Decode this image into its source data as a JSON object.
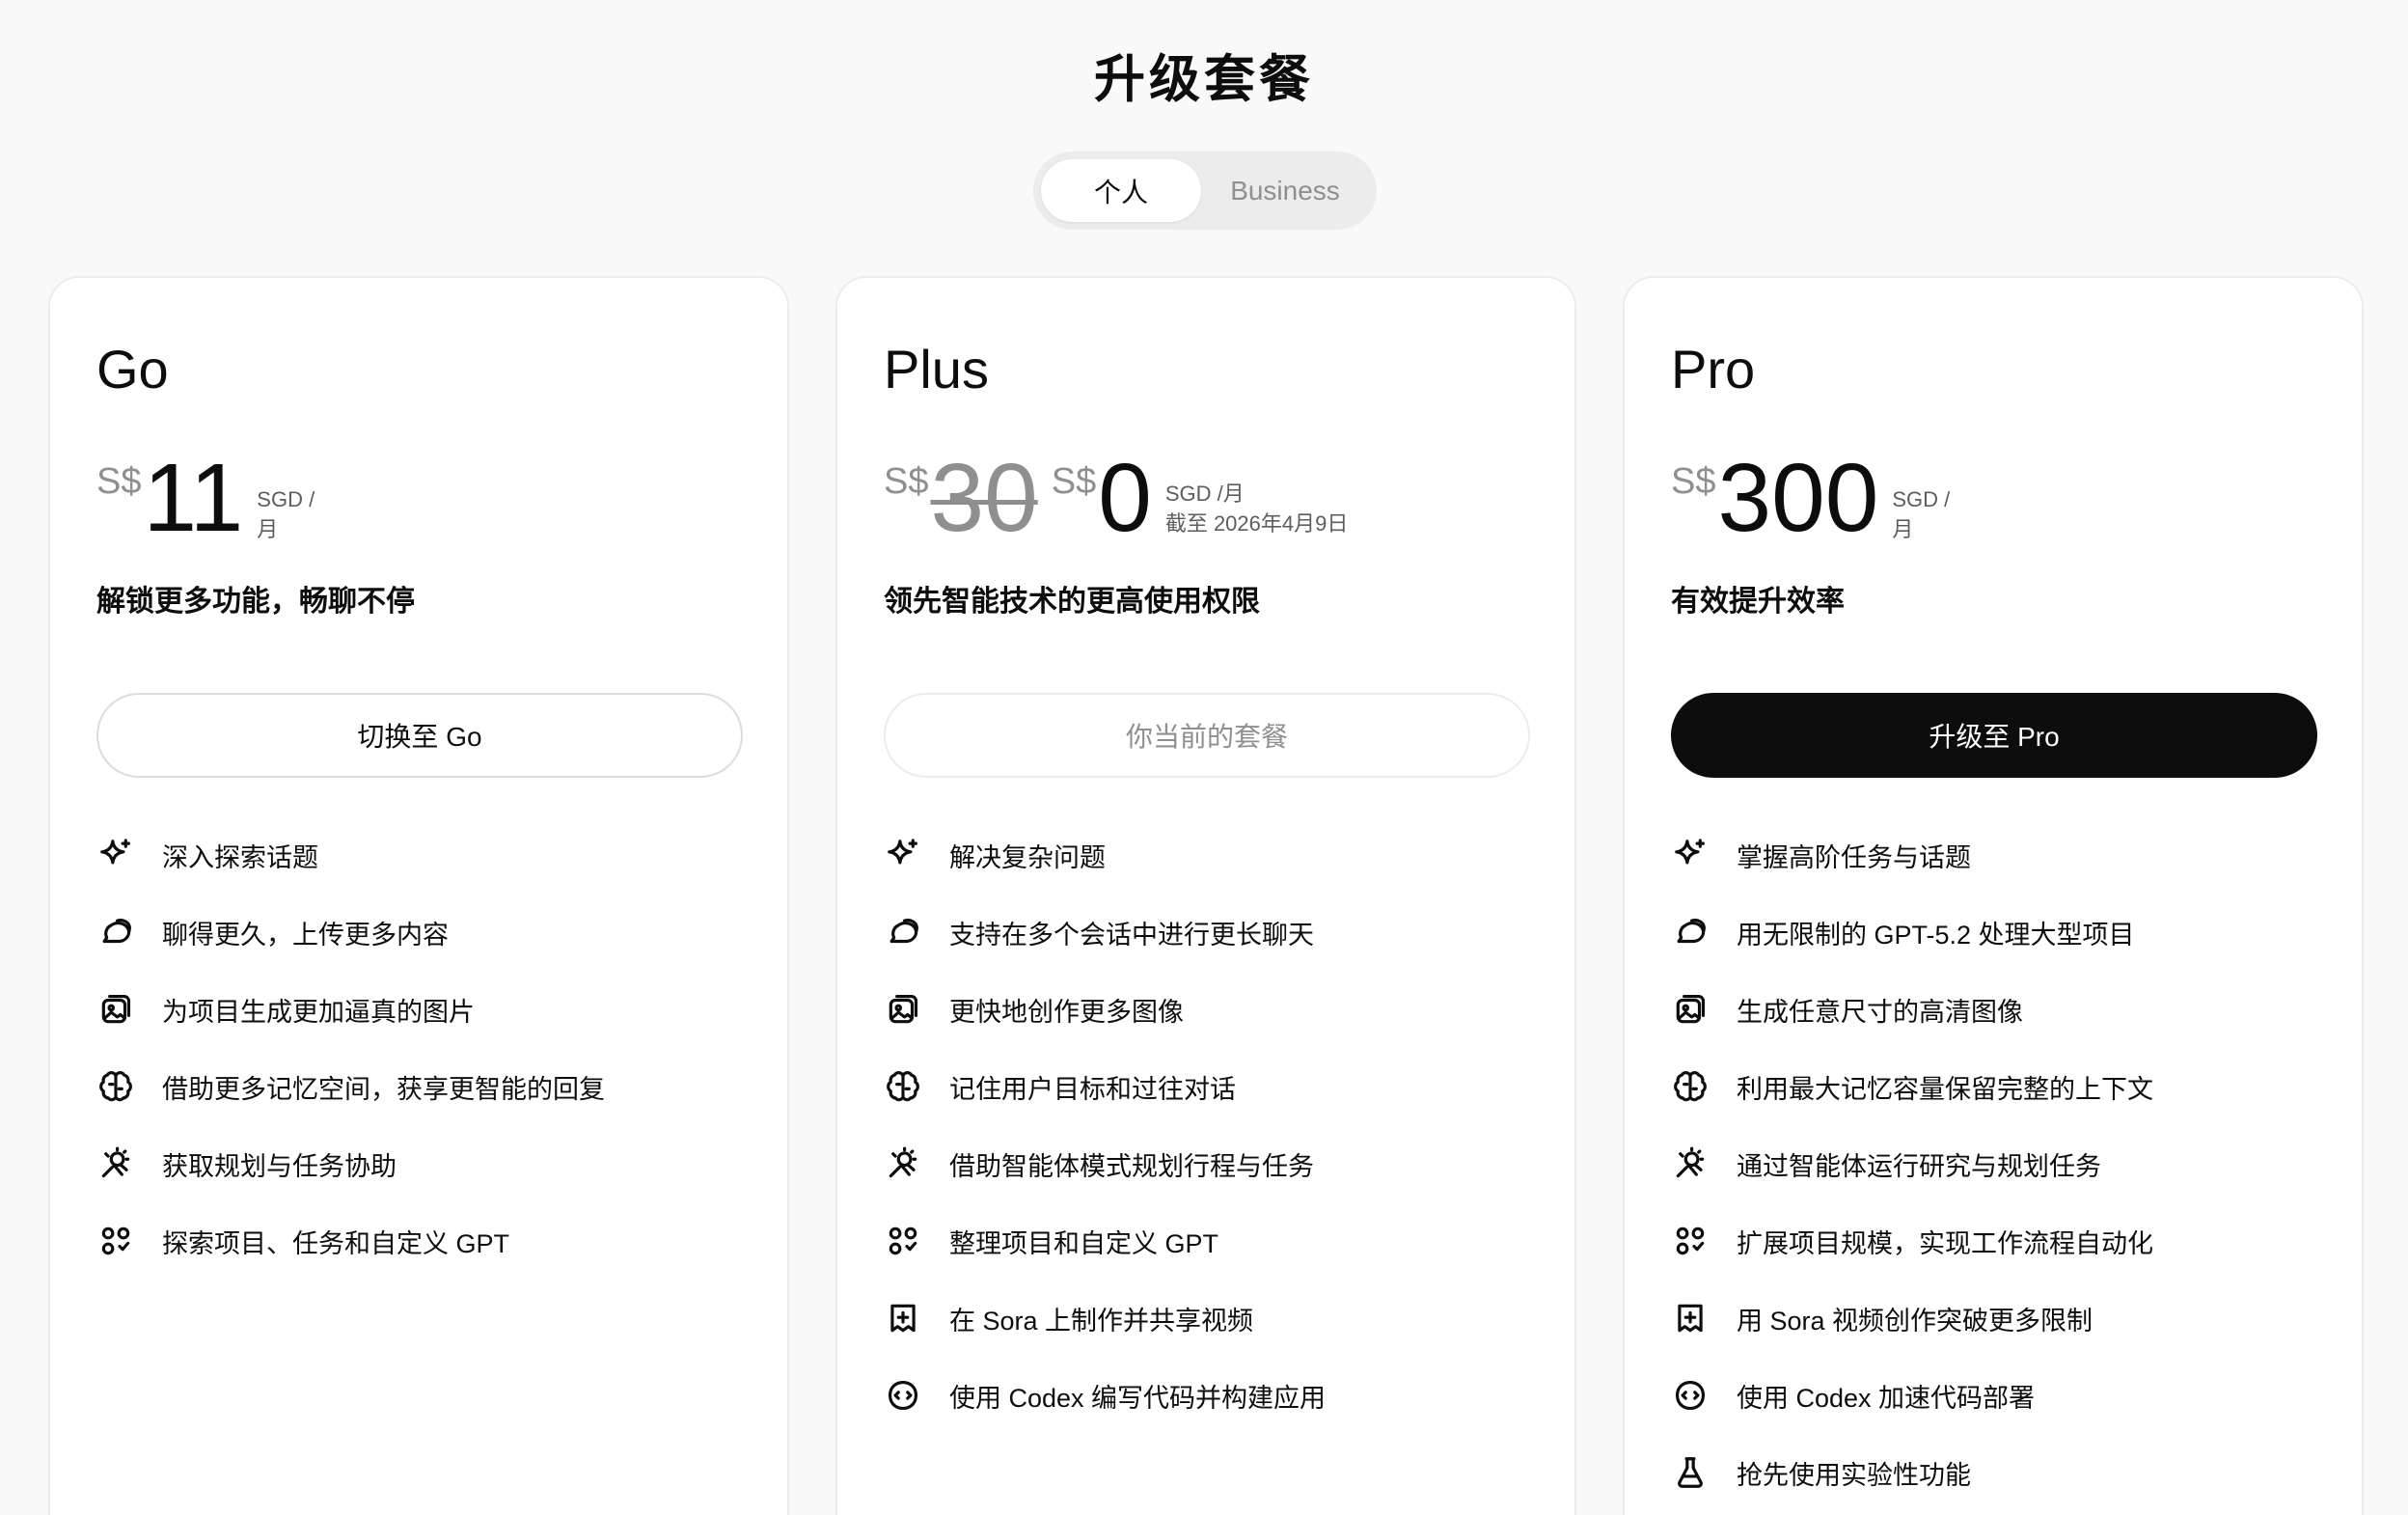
{
  "title": "升级套餐",
  "toggle": {
    "personal": "个人",
    "business": "Business"
  },
  "plans": {
    "go": {
      "name": "Go",
      "currency": "S$",
      "price": "11",
      "unit_line1": "SGD /",
      "unit_line2": "月",
      "tagline": "解锁更多功能，畅聊不停",
      "cta": "切换至 Go",
      "features": [
        "深入探索话题",
        "聊得更久，上传更多内容",
        "为项目生成更加逼真的图片",
        "借助更多记忆空间，获享更智能的回复",
        "获取规划与任务协助",
        "探索项目、任务和自定义 GPT"
      ]
    },
    "plus": {
      "name": "Plus",
      "currency": "S$",
      "old_price": "30",
      "price": "0",
      "unit_line1": "SGD /月",
      "unit_line2": "截至 2026年4月9日",
      "tagline": "领先智能技术的更高使用权限",
      "cta": "你当前的套餐",
      "features": [
        "解决复杂问题",
        "支持在多个会话中进行更长聊天",
        "更快地创作更多图像",
        "记住用户目标和过往对话",
        "借助智能体模式规划行程与任务",
        "整理项目和自定义 GPT",
        "在 Sora 上制作并共享视频",
        "使用 Codex 编写代码并构建应用"
      ]
    },
    "pro": {
      "name": "Pro",
      "currency": "S$",
      "price": "300",
      "unit_line1": "SGD /",
      "unit_line2": "月",
      "tagline": "有效提升效率",
      "cta": "升级至 Pro",
      "features": [
        "掌握高阶任务与话题",
        "用无限制的 GPT-5.2 处理大型项目",
        "生成任意尺寸的高清图像",
        "利用最大记忆容量保留完整的上下文",
        "通过智能体运行研究与规划任务",
        "扩展项目规模，实现工作流程自动化",
        "用 Sora 视频创作突破更多限制",
        "使用 Codex 加速代码部署",
        "抢先使用实验性功能"
      ]
    }
  },
  "icons": [
    "sparkle-icon",
    "chat-bubbles-icon",
    "image-icon",
    "brain-icon",
    "agent-icon",
    "apps-icon",
    "sora-icon",
    "codex-icon",
    "flask-icon"
  ]
}
